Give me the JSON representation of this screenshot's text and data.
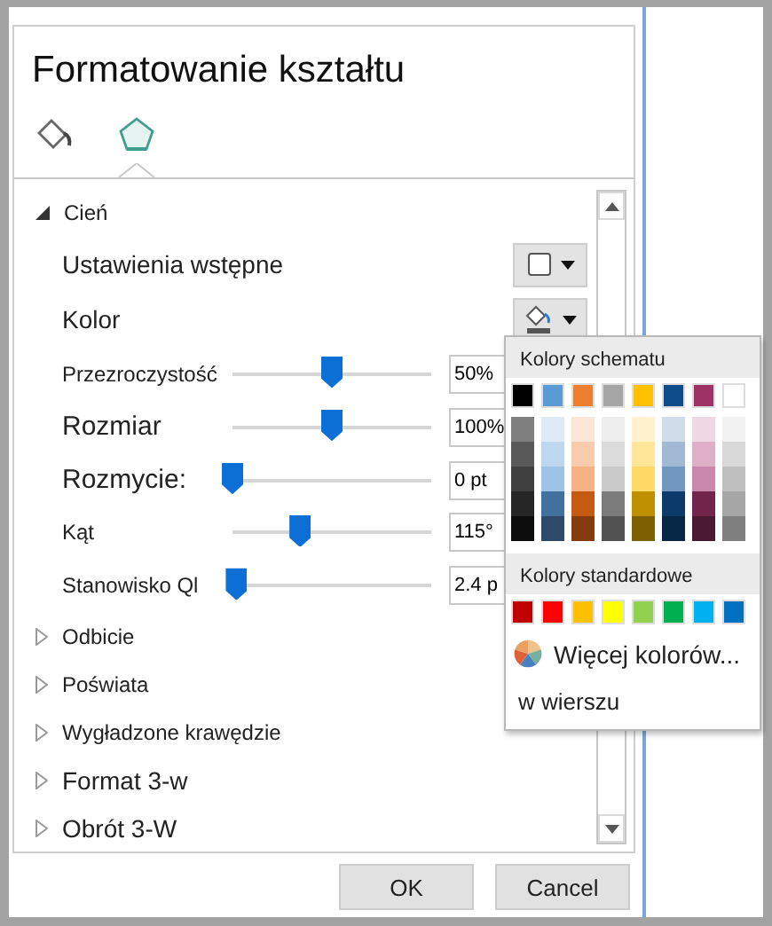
{
  "panel": {
    "title": "Formatowanie kształtu",
    "tabs": [
      {
        "selected": false
      },
      {
        "selected": true
      }
    ]
  },
  "sections": [
    {
      "label": "Cień",
      "expanded": true,
      "rows": [
        {
          "kind": "dropdown",
          "label": "Ustawienia wstępne"
        },
        {
          "kind": "dropdown",
          "label": "Kolor"
        },
        {
          "kind": "slider",
          "label": "Przezroczystość",
          "level": 0.5,
          "value": "50%"
        },
        {
          "kind": "slider",
          "label": "Rozmiar",
          "level": 0.5,
          "value": "100%"
        },
        {
          "kind": "slider",
          "label": "Rozmycie:",
          "level": 0.0,
          "value": "0 pt"
        },
        {
          "kind": "slider",
          "label": "Kąt",
          "level": 0.34,
          "value": "115°"
        },
        {
          "kind": "slider",
          "label": "Stanowisko Ql",
          "level": 0.02,
          "value": "2.4 p"
        }
      ]
    },
    {
      "label": "Odbicie",
      "expanded": false
    },
    {
      "label": "Poświata",
      "expanded": false
    },
    {
      "label": "Wygładzone krawędzie",
      "expanded": false
    },
    {
      "label": "Format 3-w",
      "expanded": false
    },
    {
      "label": "Obrót 3-W",
      "expanded": false
    }
  ],
  "color_popup": {
    "theme_heading": "Kolory schematu",
    "theme_colors": [
      {
        "color": "#000000",
        "shades": [
          {
            "color": "#7f7f7f"
          },
          {
            "color": "#595959"
          },
          {
            "color": "#3f3f3f"
          },
          {
            "color": "#262626"
          },
          {
            "color": "#0d0d0d"
          }
        ]
      },
      {
        "color": "#5b9bd5",
        "shades": [
          {
            "color": "#deebf7"
          },
          {
            "color": "#bdd7ee"
          },
          {
            "color": "#9dc3e6"
          },
          {
            "color": "#41719c"
          },
          {
            "color": "#2e4a6b"
          }
        ]
      },
      {
        "color": "#ed7d31",
        "shades": [
          {
            "color": "#fbe5d6"
          },
          {
            "color": "#f8cbad"
          },
          {
            "color": "#f4b183"
          },
          {
            "color": "#c55a11"
          },
          {
            "color": "#843c0c"
          }
        ]
      },
      {
        "color": "#a5a5a5",
        "shades": [
          {
            "color": "#ededed"
          },
          {
            "color": "#dbdbdb"
          },
          {
            "color": "#c9c9c9"
          },
          {
            "color": "#7b7b7b"
          },
          {
            "color": "#525252"
          }
        ]
      },
      {
        "color": "#ffc000",
        "shades": [
          {
            "color": "#fff2cc"
          },
          {
            "color": "#ffe699"
          },
          {
            "color": "#ffd966"
          },
          {
            "color": "#bf9000"
          },
          {
            "color": "#7f6000"
          }
        ]
      },
      {
        "color": "#0f4c8c",
        "shades": [
          {
            "color": "#d0dcea"
          },
          {
            "color": "#a1b9d4"
          },
          {
            "color": "#7196c0"
          },
          {
            "color": "#0b3a6b"
          },
          {
            "color": "#072746"
          }
        ]
      },
      {
        "color": "#9e3265",
        "shades": [
          {
            "color": "#efd7e3"
          },
          {
            "color": "#dfafc7"
          },
          {
            "color": "#c987ab"
          },
          {
            "color": "#72244a"
          },
          {
            "color": "#4b1831"
          }
        ]
      },
      {
        "color": "#ffffff",
        "shades": [
          {
            "color": "#f2f2f2"
          },
          {
            "color": "#d9d9d9"
          },
          {
            "color": "#bfbfbf"
          },
          {
            "color": "#a6a6a6"
          },
          {
            "color": "#7f7f7f"
          }
        ]
      }
    ],
    "standard_heading": "Kolory standardowe",
    "standard_colors": [
      {
        "color": "#c00000"
      },
      {
        "color": "#ff0000"
      },
      {
        "color": "#ffc000"
      },
      {
        "color": "#ffff00"
      },
      {
        "color": "#92d050"
      },
      {
        "color": "#00b050"
      },
      {
        "color": "#00b0f0"
      },
      {
        "color": "#0070c0"
      }
    ],
    "more_colors": "Więcej kolorów...",
    "footer": "w wierszu"
  },
  "buttons": [
    "OK",
    "Cancel"
  ]
}
